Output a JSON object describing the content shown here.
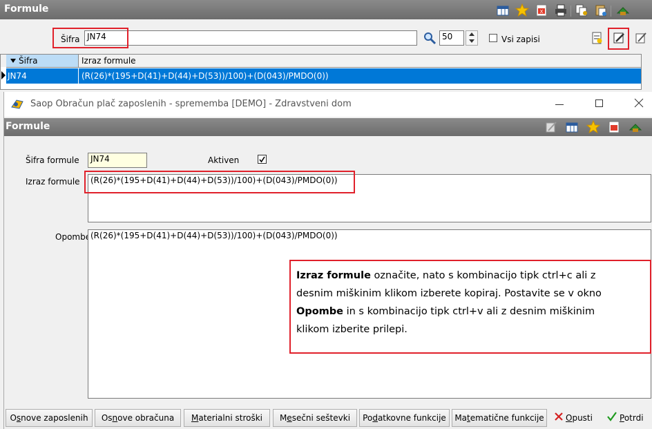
{
  "main_panel": {
    "title": "Formule",
    "search": {
      "label": "Šifra",
      "value": "JN74",
      "page_size": "50",
      "all_records_label": "Vsi zapisi"
    },
    "grid": {
      "columns": [
        "Šifra",
        "Izraz formule"
      ],
      "rows": [
        {
          "sifra": "JN74",
          "izraz": "(R(26)*(195+D(41)+D(44)+D(53))/100)+(D(043)/PMDO(0))"
        }
      ]
    }
  },
  "dialog": {
    "window_title": "Saop Obračun plač zaposlenih - sprememba [DEMO] - Zdravstveni dom",
    "header": "Formule",
    "sifra_label": "Šifra formule",
    "sifra_value": "JN74",
    "aktiven_label": "Aktiven",
    "aktiven_checked": true,
    "izraz_label": "Izraz formule",
    "izraz_value": "(R(26)*(195+D(41)+D(44)+D(53))/100)+(D(043)/PMDO(0))",
    "opombe_label": "Opombe",
    "opombe_value": "(R(26)*(195+D(41)+D(44)+D(53))/100)+(D(043)/PMDO(0))"
  },
  "callout": {
    "line1_bold": "Izraz formule",
    "line1_rest": " označite, nato s kombinacijo tipk ctrl+c ali z",
    "line2": "desnim miškinim klikom izberete kopiraj. Postavite se v okno",
    "line3_bold": "Opombe",
    "line3_rest": " in s kombinacijo tipk ctrl+v ali z desnim miškinim",
    "line4": "klikom izberite prilepi."
  },
  "buttons": {
    "osnove_zaposlenih": {
      "pre": "O",
      "u": "s",
      "post": "nove zaposlenih"
    },
    "osnove_obracuna": {
      "pre": "Os",
      "u": "n",
      "post": "ove obračuna"
    },
    "materialni_stroski": {
      "pre": "",
      "u": "M",
      "post": "aterialni stroški"
    },
    "mesecni_sestevki": {
      "pre": "M",
      "u": "e",
      "post": "sečni seštevki"
    },
    "podatkovne_funkcije": {
      "pre": "Po",
      "u": "d",
      "post": "atkovne funkcije"
    },
    "matematicne_funkcije": {
      "pre": "Ma",
      "u": "t",
      "post": "ematične funkcije"
    },
    "opusti": {
      "pre": "",
      "u": "O",
      "post": "pusti"
    },
    "potrdi": {
      "pre": "",
      "u": "P",
      "post": "otrdi"
    }
  },
  "colors": {
    "title_gray": "#767676",
    "selection_blue": "#0078d7",
    "highlight_red": "#e0202a",
    "field_yellow": "#ffffe1"
  }
}
